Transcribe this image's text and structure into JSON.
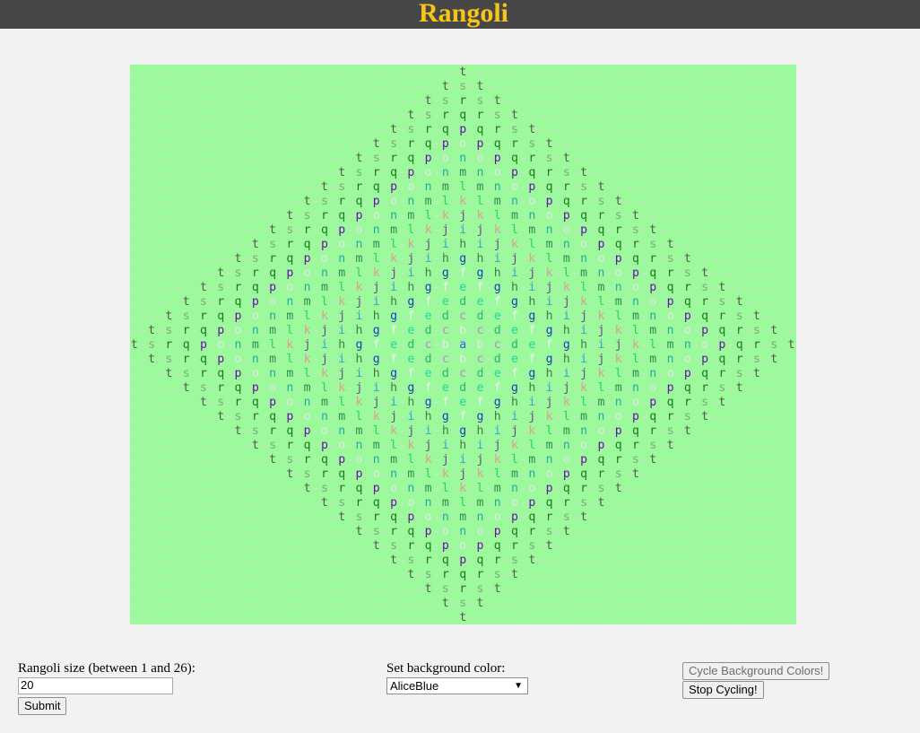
{
  "header": {
    "title": "Rangoli"
  },
  "rangoli": {
    "size": 20,
    "background_color": "#9cf99c",
    "letters": "abcdefghijklmnopqrst",
    "letter_colors": {
      "a": "#3d5cff",
      "b": "#e8e8e8",
      "c": "#c77dd9",
      "d": "#2fb36b",
      "e": "#1fd6a0",
      "f": "#f2f2f2",
      "g": "#1a3fb8",
      "h": "#4a7a4a",
      "i": "#4a9ad1",
      "j": "#6a4a8a",
      "k": "#e09a9a",
      "l": "#2ecc71",
      "m": "#2e8b57",
      "n": "#2aa8a8",
      "o": "#e6e6e6",
      "p": "#6a0dad",
      "q": "#1e7a1e",
      "r": "#2f6b2f",
      "s": "#7ea87e",
      "t": "#555555"
    },
    "dash_color": "#dddddd"
  },
  "controls": {
    "size_label": "Rangoli size (between 1 and 26):",
    "size_value": "20",
    "submit_label": "Submit",
    "bg_label": "Set background color:",
    "bg_selected": "AliceBlue",
    "cycle_label": "Cycle Background Colors!",
    "stop_label": "Stop Cycling!"
  }
}
